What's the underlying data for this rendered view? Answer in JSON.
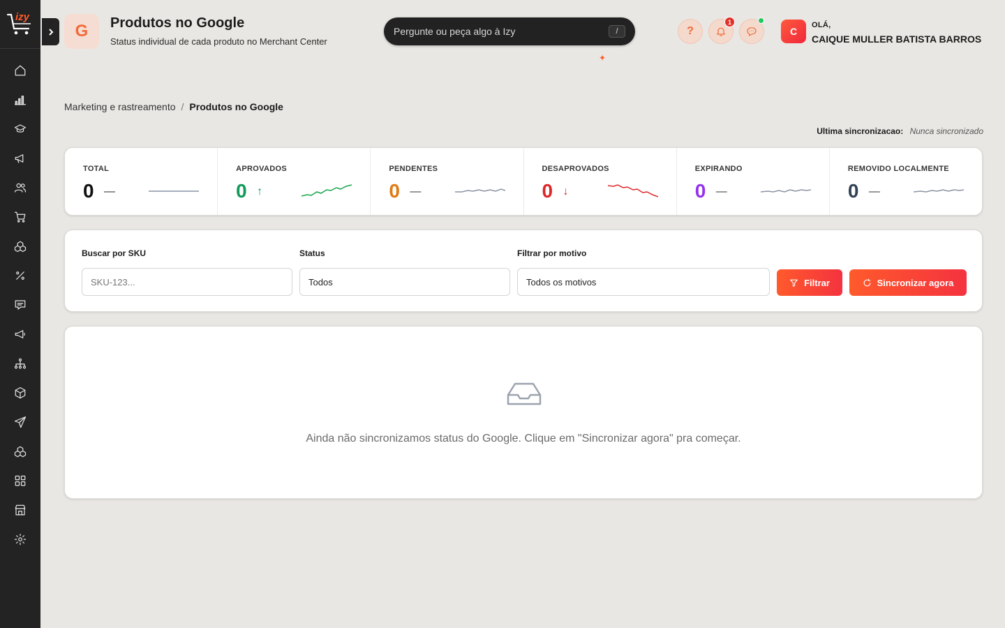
{
  "brand": {
    "logo_text": "izy"
  },
  "header": {
    "icon_letter": "G",
    "title": "Produtos no Google",
    "subtitle": "Status individual de cada produto no Merchant Center",
    "ai_placeholder": "Pergunte ou peça algo à Izy",
    "ai_shortcut": "/",
    "help_label": "?",
    "notifications_count": "1",
    "user": {
      "avatar_letter": "C",
      "greeting": "OLÁ,",
      "name": "CAIQUE MULLER BATISTA BARROS"
    }
  },
  "sidebar": {
    "items": [
      "home-icon",
      "chart-icon",
      "graduation-icon",
      "megaphone-icon",
      "users-icon",
      "cart-icon",
      "boxes-icon",
      "percent-icon",
      "message-icon",
      "megaphone-2-icon",
      "network-icon",
      "package-icon",
      "send-icon",
      "boxes-2-icon",
      "apps-icon",
      "store-icon",
      "settings-icon"
    ]
  },
  "breadcrumb": {
    "parent": "Marketing e rastreamento",
    "separator": "/",
    "current": "Produtos no Google"
  },
  "sync": {
    "label": "Ultima sincronizacao:",
    "value": "Nunca sincronizado"
  },
  "stats": [
    {
      "label": "TOTAL",
      "value": "0",
      "trend": "—",
      "color": "#111111"
    },
    {
      "label": "APROVADOS",
      "value": "0",
      "trend": "↑",
      "color": "#0f9a5a"
    },
    {
      "label": "PENDENTES",
      "value": "0",
      "trend": "—",
      "color": "#e07b13"
    },
    {
      "label": "DESAPROVADOS",
      "value": "0",
      "trend": "↓",
      "color": "#dc2626"
    },
    {
      "label": "EXPIRANDO",
      "value": "0",
      "trend": "—",
      "color": "#9333ea"
    },
    {
      "label": "REMOVIDO LOCALMENTE",
      "value": "0",
      "trend": "—",
      "color": "#334155"
    }
  ],
  "filters": {
    "sku_label": "Buscar por SKU",
    "sku_placeholder": "SKU-123...",
    "status_label": "Status",
    "status_value": "Todos",
    "reason_label": "Filtrar por motivo",
    "reason_value": "Todos os motivos",
    "filter_button": "Filtrar",
    "sync_button": "Sincronizar agora"
  },
  "empty_state": {
    "message": "Ainda não sincronizamos status do Google. Clique em \"Sincronizar agora\" pra começar."
  }
}
